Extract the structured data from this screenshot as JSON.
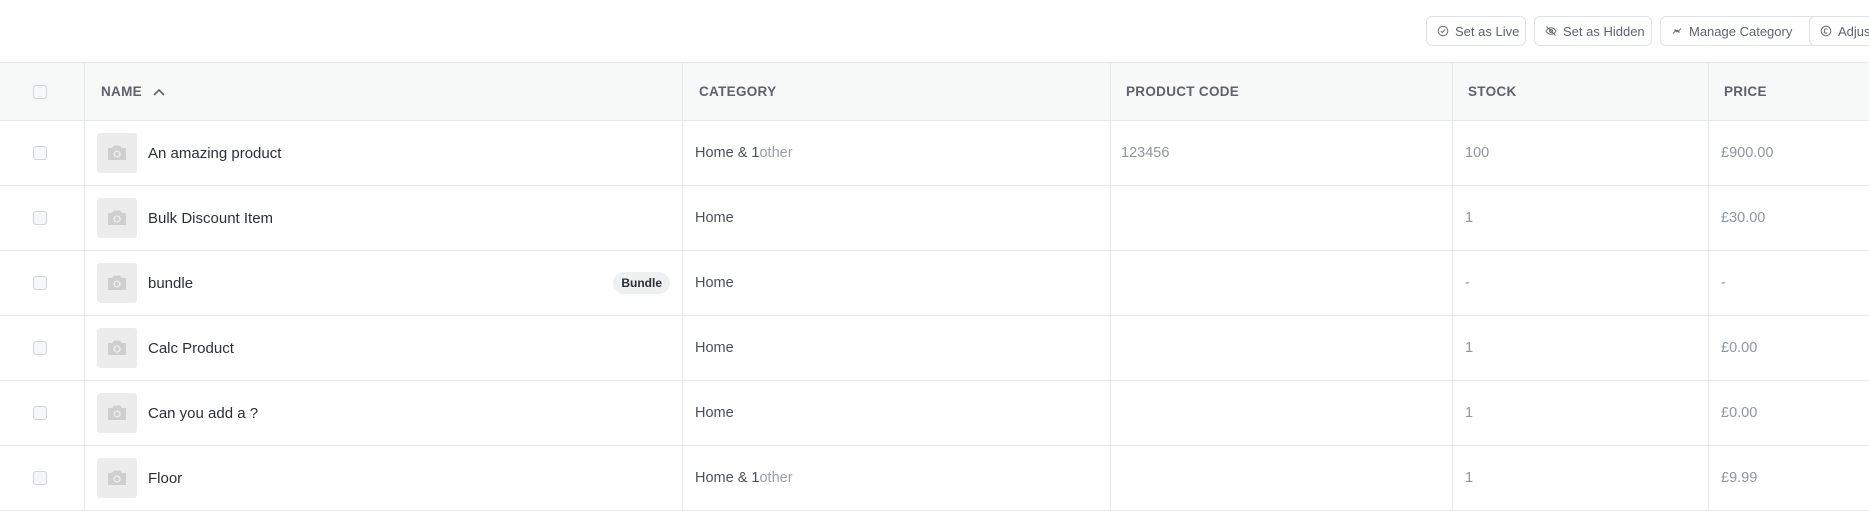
{
  "toolbar": {
    "set_live": "Set as Live",
    "set_hidden": "Set as Hidden",
    "manage_category": "Manage Category",
    "adjust": "Adjus"
  },
  "columns": {
    "name": "NAME",
    "category": "CATEGORY",
    "product_code": "PRODUCT CODE",
    "stock": "STOCK",
    "price": "PRICE"
  },
  "rows": [
    {
      "name": "An amazing product",
      "category": "Home & 1",
      "category_extra": " other",
      "code": "123456",
      "stock": "100",
      "price": "£900.00",
      "badge": ""
    },
    {
      "name": "Bulk Discount Item",
      "category": "Home",
      "category_extra": "",
      "code": "",
      "stock": "1",
      "price": "£30.00",
      "badge": ""
    },
    {
      "name": "bundle",
      "category": "Home",
      "category_extra": "",
      "code": "",
      "stock": "-",
      "price": "-",
      "badge": "Bundle"
    },
    {
      "name": "Calc Product",
      "category": "Home",
      "category_extra": "",
      "code": "",
      "stock": "1",
      "price": "£0.00",
      "badge": ""
    },
    {
      "name": "Can you add a ?",
      "category": "Home",
      "category_extra": "",
      "code": "",
      "stock": "1",
      "price": "£0.00",
      "badge": ""
    },
    {
      "name": "Floor",
      "category": "Home & 1",
      "category_extra": " other",
      "code": "",
      "stock": "1",
      "price": "£9.99",
      "badge": ""
    }
  ],
  "icons": {
    "set_live": "check-circle-icon",
    "set_hidden": "eye-off-icon",
    "manage_category": "swap-arrows-icon",
    "adjust": "currency-circle-icon",
    "sort": "chevron-up-icon",
    "thumbnail": "camera-icon"
  }
}
